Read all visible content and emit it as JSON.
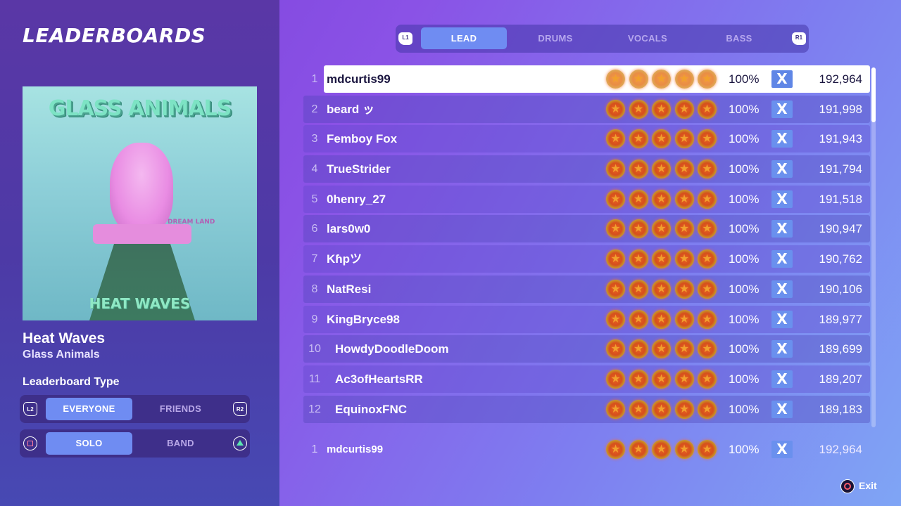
{
  "screen": {
    "title": "LEADERBOARDS"
  },
  "song": {
    "art_band_text": "GLASS ANIMALS",
    "art_title_text": "HEAT WAVES",
    "art_dream_text": "DREAM LAND",
    "title": "Heat Waves",
    "artist": "Glass Animals"
  },
  "leaderboard_type": {
    "label": "Leaderboard Type",
    "scope": {
      "left_button": "L2",
      "right_button": "R2",
      "options": [
        "EVERYONE",
        "FRIENDS"
      ],
      "selected": "EVERYONE"
    },
    "mode": {
      "options": [
        "SOLO",
        "BAND"
      ],
      "selected": "SOLO"
    }
  },
  "instrument_tabs": {
    "left_button": "L1",
    "right_button": "R1",
    "tabs": [
      "LEAD",
      "DRUMS",
      "VOCALS",
      "BASS"
    ],
    "selected": "LEAD"
  },
  "entries": [
    {
      "rank": "1",
      "name": "mdcurtis99",
      "stars": 5,
      "accuracy": "100%",
      "fc": "X",
      "score": "192,964"
    },
    {
      "rank": "2",
      "name": "beard ッ",
      "stars": 5,
      "accuracy": "100%",
      "fc": "X",
      "score": "191,998"
    },
    {
      "rank": "3",
      "name": "Femboy Fox",
      "stars": 5,
      "accuracy": "100%",
      "fc": "X",
      "score": "191,943"
    },
    {
      "rank": "4",
      "name": "TrueStrider",
      "stars": 5,
      "accuracy": "100%",
      "fc": "X",
      "score": "191,794"
    },
    {
      "rank": "5",
      "name": "0henry_27",
      "stars": 5,
      "accuracy": "100%",
      "fc": "X",
      "score": "191,518"
    },
    {
      "rank": "6",
      "name": "lars0w0",
      "stars": 5,
      "accuracy": "100%",
      "fc": "X",
      "score": "190,947"
    },
    {
      "rank": "7",
      "name": "Kɦpツ",
      "stars": 5,
      "accuracy": "100%",
      "fc": "X",
      "score": "190,762"
    },
    {
      "rank": "8",
      "name": "NatResi",
      "stars": 5,
      "accuracy": "100%",
      "fc": "X",
      "score": "190,106"
    },
    {
      "rank": "9",
      "name": "KingBryce98",
      "stars": 5,
      "accuracy": "100%",
      "fc": "X",
      "score": "189,977"
    },
    {
      "rank": "10",
      "name": "HowdyDoodleDoom",
      "stars": 5,
      "accuracy": "100%",
      "fc": "X",
      "score": "189,699"
    },
    {
      "rank": "11",
      "name": "Ac3ofHeartsRR",
      "stars": 5,
      "accuracy": "100%",
      "fc": "X",
      "score": "189,207"
    },
    {
      "rank": "12",
      "name": "EquinoxFNC",
      "stars": 5,
      "accuracy": "100%",
      "fc": "X",
      "score": "189,183"
    }
  ],
  "my_entry": {
    "rank": "1",
    "name": "mdcurtis99",
    "stars": 5,
    "accuracy": "100%",
    "fc": "X",
    "score": "192,964"
  },
  "footer": {
    "exit_label": "Exit"
  },
  "colors": {
    "accent": "#6f8cf2",
    "highlight_row": "#ffffff",
    "panel": "#5a37a6"
  }
}
